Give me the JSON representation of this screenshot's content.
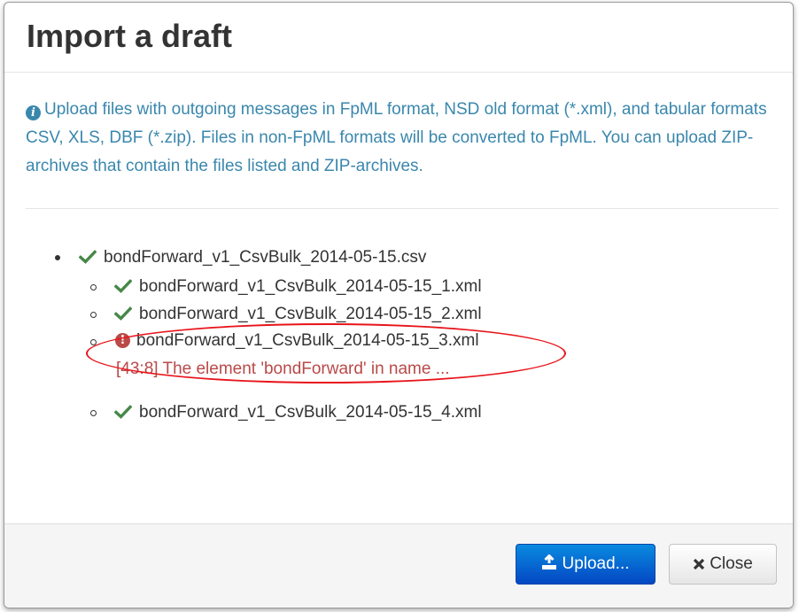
{
  "dialog": {
    "title": "Import a draft",
    "info_text": "Upload files with outgoing messages in FpML format, NSD old format (*.xml), and tabular formats CSV, XLS, DBF (*.zip). Files in non-FpML formats will be converted to FpML. You can upload ZIP-archives that contain the files listed and ZIP-archives."
  },
  "files": {
    "archive": {
      "name": "bondForward_v1_CsvBulk_2014-05-15.csv",
      "status": "ok",
      "status_icon": "check-icon"
    },
    "children": [
      {
        "name": "bondForward_v1_CsvBulk_2014-05-15_1.xml",
        "status": "ok",
        "status_icon": "check-icon"
      },
      {
        "name": "bondForward_v1_CsvBulk_2014-05-15_2.xml",
        "status": "ok",
        "status_icon": "check-icon"
      },
      {
        "name": "bondForward_v1_CsvBulk_2014-05-15_3.xml",
        "status": "error",
        "status_icon": "exclamation-circle-icon",
        "error": "[43:8] The element 'bondForward' in name ..."
      },
      {
        "name": "bondForward_v1_CsvBulk_2014-05-15_4.xml",
        "status": "ok",
        "status_icon": "check-icon"
      }
    ]
  },
  "footer": {
    "upload_label": "Upload...",
    "close_label": "Close"
  },
  "colors": {
    "info": "#3a87ad",
    "success": "#468847",
    "error": "#b94a48",
    "primary": "#0a6fd6",
    "highlight": "#e8141b"
  }
}
